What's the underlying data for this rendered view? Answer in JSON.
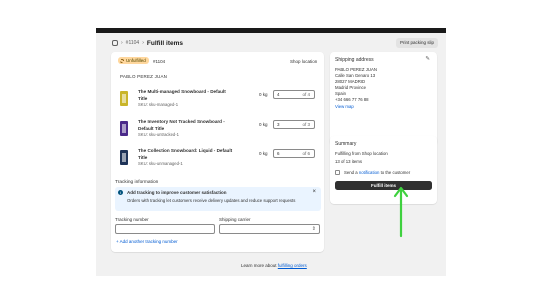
{
  "breadcrumb": {
    "order": "#1104",
    "page_title": "Fulfill items"
  },
  "print_button": "Print packing slip",
  "fulfillment": {
    "status": "Unfulfilled",
    "order_tag": "#1104",
    "ship_to": "Shop location",
    "customer": "PABLO PEREZ JUAN",
    "items": [
      {
        "title": "The Multi-managed Snowboard - Default Title",
        "sku": "SKU: sku-managed-1",
        "weight": "0 kg",
        "qty": "4",
        "of": "of 4",
        "color": "#c9b52a"
      },
      {
        "title": "The Inventory Not Tracked Snowboard - Default Title",
        "sku": "SKU: sku-untracked-1",
        "weight": "0 kg",
        "qty": "3",
        "of": "of 3",
        "color": "#4b2a8a"
      },
      {
        "title": "The Collection Snowboard: Liquid - Default Title",
        "sku": "SKU: sku-unmanaged-1",
        "weight": "0 kg",
        "qty": "6",
        "of": "of 6",
        "color": "#1e3358"
      }
    ]
  },
  "tracking": {
    "title": "Tracking information",
    "banner_title": "Add tracking to improve customer satisfaction",
    "banner_body": "Orders with tracking let customers receive delivery updates and reduce support requests",
    "number_label": "Tracking number",
    "carrier_label": "Shipping carrier",
    "add_link": "+ Add another tracking number"
  },
  "shipping_address": {
    "title": "Shipping address",
    "lines": [
      "PABLO PEREZ JUAN",
      "Calle San Genaro 13",
      "28027 MADRID",
      "Madrid Province",
      "Spain",
      "+34 666 77 76 88"
    ],
    "map_link": "View map",
    "note_pre": "The customer selected ",
    "note_bold": "Shipping",
    "note_post": " at checkout"
  },
  "summary": {
    "title": "Summary",
    "from": "Fulfilling from Shop location",
    "count": "13 of 13 items",
    "send_pre": "Send a ",
    "send_link": "notification",
    "send_post": " to the customer",
    "fulfill_button": "Fulfill items"
  },
  "footer": {
    "text": "Learn more about ",
    "link": "fulfilling orders"
  },
  "colors": {
    "accent_link": "#005bd3",
    "annotation_arrow": "#3fd13f",
    "badge": "#ffd79d"
  }
}
